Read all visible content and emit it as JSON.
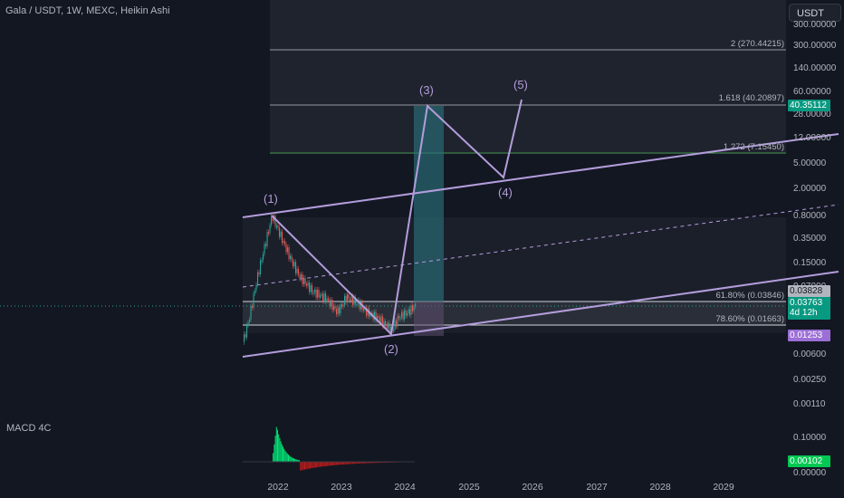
{
  "header": {
    "title": "Gala / USDT, 1W, MEXC, Heikin Ashi"
  },
  "currency_button": "USDT",
  "indicator": {
    "name": "MACD 4C"
  },
  "price_axis": {
    "ticks": [
      "300.00000",
      "140.00000",
      "60.00000",
      "28.00000",
      "12.00000",
      "5.00000",
      "2.00000",
      "0.80000",
      "0.35000",
      "0.15000",
      "0.07000",
      "0.00600",
      "0.00250",
      "0.00110"
    ]
  },
  "macd_axis": {
    "ticks": [
      "0.10000",
      "0.00000"
    ]
  },
  "time_axis": {
    "ticks": [
      "2022",
      "2023",
      "2024",
      "2025",
      "2026",
      "2027",
      "2028",
      "2029"
    ]
  },
  "badges": {
    "target": "40.35112",
    "level_1": "0.03828",
    "price": "0.03763",
    "countdown": "4d 12h",
    "low": "0.01253",
    "macd_value": "0.00102"
  },
  "fib_levels": {
    "ext_2": "2 (270.44215)",
    "ext_1618": "1.618 (40.20897)",
    "ext_1272": "1.272 (7.15450)",
    "ret_618": "61.80% (0.03846)",
    "ret_786": "78.60% (0.01663)"
  },
  "waves": [
    "(1)",
    "(2)",
    "(3)",
    "(4)",
    "(5)"
  ],
  "colors": {
    "background": "#131722",
    "channel": "#b39ddb",
    "up": "#26a69a",
    "down": "#ef5350",
    "macd_up": "#00e676",
    "macd_down": "#b71c1c",
    "projection": "#2a6f7a"
  }
}
